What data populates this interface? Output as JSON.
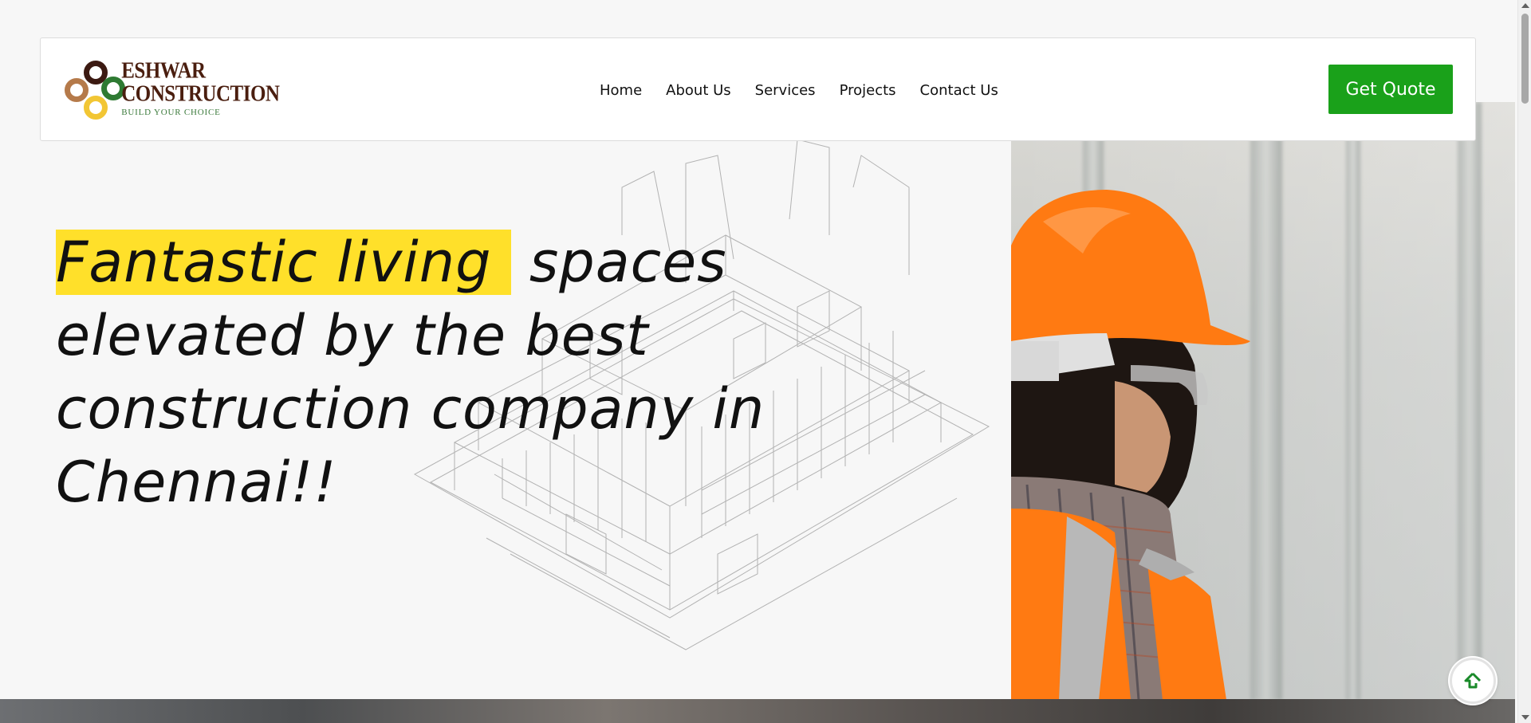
{
  "brand": {
    "name": "ESHWAR CONSTRUCTION",
    "tagline": "BUILD YOUR CHOICE",
    "colors": {
      "ring_dark_brown": "#3c1a12",
      "ring_green": "#2e7a32",
      "ring_tan": "#b57a4a",
      "ring_yellow": "#f2c634"
    }
  },
  "nav": {
    "items": [
      {
        "label": "Home"
      },
      {
        "label": "About Us"
      },
      {
        "label": "Services"
      },
      {
        "label": "Projects"
      },
      {
        "label": "Contact Us"
      }
    ]
  },
  "header": {
    "cta_label": "Get Quote",
    "cta_color": "#1aa11a"
  },
  "hero": {
    "line1_highlight": "Fantastic living",
    "line1_rest": "spaces",
    "line2": "elevated by the best",
    "line3": "construction company in",
    "line4": "Chennai!!",
    "highlight_color": "#ffe02a"
  },
  "icons": {
    "scroll_top": "arrow-up-icon"
  }
}
